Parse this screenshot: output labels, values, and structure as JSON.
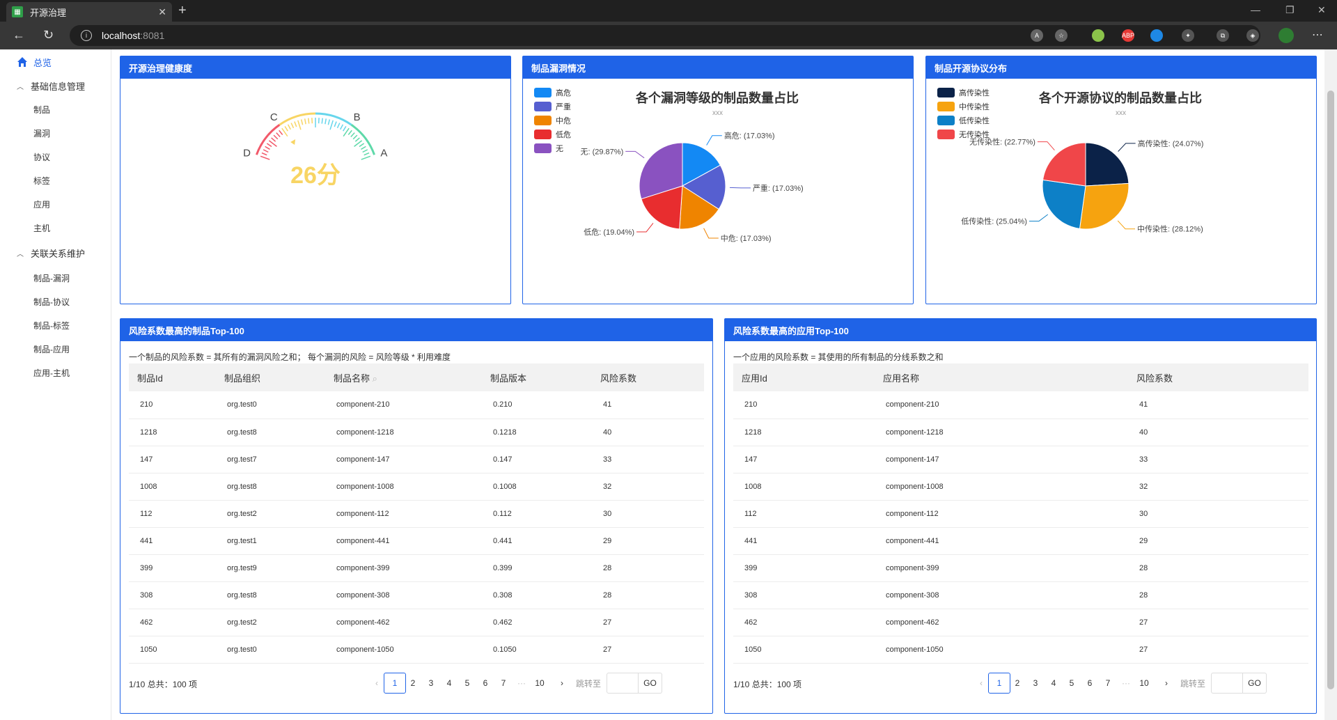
{
  "browser": {
    "tab_title": "开源治理",
    "url_host": "localhost",
    "url_port": ":8081"
  },
  "sidebar": {
    "overview": "总览",
    "group1": "基础信息管理",
    "group1_items": [
      "制品",
      "漏洞",
      "协议",
      "标签",
      "应用",
      "主机"
    ],
    "group2": "关联关系维护",
    "group2_items": [
      "制品-漏洞",
      "制品-协议",
      "制品-标签",
      "制品-应用",
      "应用-主机"
    ]
  },
  "health": {
    "title": "开源治理健康度",
    "score": "26分",
    "score_value": 26,
    "grades": [
      "D",
      "C",
      "B",
      "A"
    ]
  },
  "vuln": {
    "title": "制品漏洞情况",
    "chart_title": "各个漏洞等级的制品数量占比",
    "chart_sub": "xxx"
  },
  "license": {
    "title": "制品开源协议分布",
    "chart_title": "各个开源协议的制品数量占比",
    "chart_sub": "xxx"
  },
  "chart_data": [
    {
      "type": "pie",
      "title": "各个漏洞等级的制品数量占比",
      "subtitle": "xxx",
      "legend": "top-left",
      "slices": [
        {
          "name": "高危",
          "value": 17.03,
          "label": "高危: (17.03%)",
          "color": "#1389f4"
        },
        {
          "name": "严重",
          "value": 17.03,
          "label": "严重: (17.03%)",
          "color": "#565fd0"
        },
        {
          "name": "中危",
          "value": 17.03,
          "label": "中危: (17.03%)",
          "color": "#ef8400"
        },
        {
          "name": "低危",
          "value": 19.04,
          "label": "低危: (19.04%)",
          "color": "#e82d2f"
        },
        {
          "name": "无",
          "value": 29.87,
          "label": "无: (29.87%)",
          "color": "#8a52c0"
        }
      ]
    },
    {
      "type": "pie",
      "title": "各个开源协议的制品数量占比",
      "subtitle": "xxx",
      "legend": "top-left",
      "slices": [
        {
          "name": "高传染性",
          "value": 24.07,
          "label": "高传染性: (24.07%)",
          "color": "#0b2248"
        },
        {
          "name": "中传染性",
          "value": 28.12,
          "label": "中传染性: (28.12%)",
          "color": "#f6a30f"
        },
        {
          "name": "低传染性",
          "value": 25.04,
          "label": "低传染性: (25.04%)",
          "color": "#0d80c7"
        },
        {
          "name": "无传染性",
          "value": 22.77,
          "label": "无传染性: (22.77%)",
          "color": "#f04649"
        }
      ]
    }
  ],
  "product_table": {
    "title": "风险系数最高的制品Top-100",
    "desc": "一个制品的风险系数 = 其所有的漏洞风险之和； 每个漏洞的风险 = 风险等级 * 利用难度",
    "columns": [
      "制品Id",
      "制品组织",
      "制品名称",
      "制品版本",
      "风险系数"
    ],
    "rows": [
      [
        "210",
        "org.test0",
        "component-210",
        "0.210",
        "41"
      ],
      [
        "1218",
        "org.test8",
        "component-1218",
        "0.1218",
        "40"
      ],
      [
        "147",
        "org.test7",
        "component-147",
        "0.147",
        "33"
      ],
      [
        "1008",
        "org.test8",
        "component-1008",
        "0.1008",
        "32"
      ],
      [
        "112",
        "org.test2",
        "component-112",
        "0.112",
        "30"
      ],
      [
        "441",
        "org.test1",
        "component-441",
        "0.441",
        "29"
      ],
      [
        "399",
        "org.test9",
        "component-399",
        "0.399",
        "28"
      ],
      [
        "308",
        "org.test8",
        "component-308",
        "0.308",
        "28"
      ],
      [
        "462",
        "org.test2",
        "component-462",
        "0.462",
        "27"
      ],
      [
        "1050",
        "org.test0",
        "component-1050",
        "0.1050",
        "27"
      ]
    ],
    "summary": "1/10 总共：100 项"
  },
  "app_table": {
    "title": "风险系数最高的应用Top-100",
    "desc": "一个应用的风险系数 = 其使用的所有制品的分线系数之和",
    "columns": [
      "应用Id",
      "应用名称",
      "风险系数"
    ],
    "rows": [
      [
        "210",
        "component-210",
        "41"
      ],
      [
        "1218",
        "component-1218",
        "40"
      ],
      [
        "147",
        "component-147",
        "33"
      ],
      [
        "1008",
        "component-1008",
        "32"
      ],
      [
        "112",
        "component-112",
        "30"
      ],
      [
        "441",
        "component-441",
        "29"
      ],
      [
        "399",
        "component-399",
        "28"
      ],
      [
        "308",
        "component-308",
        "28"
      ],
      [
        "462",
        "component-462",
        "27"
      ],
      [
        "1050",
        "component-1050",
        "27"
      ]
    ],
    "summary": "1/10 总共：100 项"
  },
  "pagination": {
    "pages": [
      "1",
      "2",
      "3",
      "4",
      "5",
      "6",
      "7",
      "···",
      "10"
    ],
    "jump_label": "跳转至",
    "go": "GO"
  }
}
